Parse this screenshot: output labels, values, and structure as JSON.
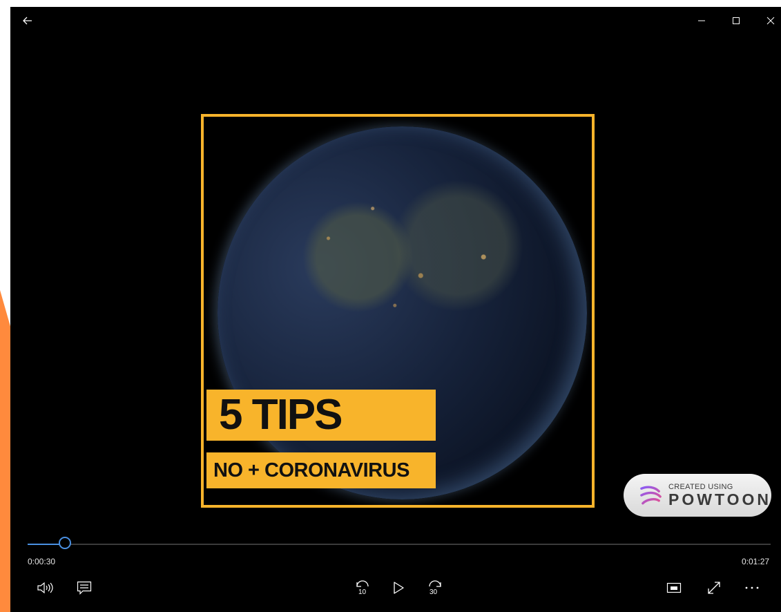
{
  "window": {
    "back_icon": "back-arrow-icon",
    "minimize_icon": "minimize-icon",
    "maximize_icon": "maximize-icon",
    "close_icon": "close-icon"
  },
  "video": {
    "title": "5 TIPS",
    "subtitle": "NO + CORONAVIRUS",
    "frame_color": "#f8b42b",
    "banner_color": "#f8b42b"
  },
  "watermark": {
    "line1": "CREATED USING",
    "line2": "POWTOON"
  },
  "playback": {
    "current_time": "0:00:30",
    "total_time": "0:01:27",
    "progress": 0.05,
    "skip_back_label": "10",
    "skip_forward_label": "30",
    "accent": "#4a90e2"
  },
  "controls": {
    "volume_icon": "volume-icon",
    "captions_icon": "captions-icon",
    "rewind_icon": "skip-back-10-icon",
    "play_icon": "play-icon",
    "forward_icon": "skip-forward-30-icon",
    "miniview_icon": "mini-view-icon",
    "fullscreen_icon": "fullscreen-icon",
    "more_icon": "more-options-icon"
  }
}
